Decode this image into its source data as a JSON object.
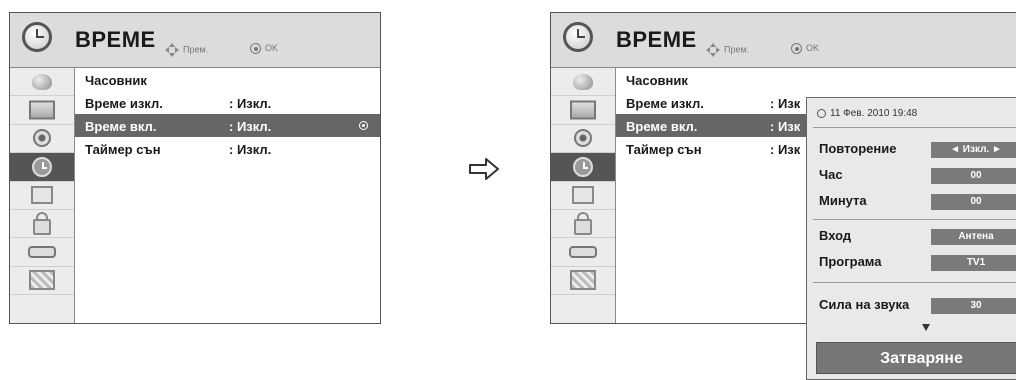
{
  "left_panel": {
    "title": "ВРЕМЕ",
    "hint_move": "Прем.",
    "hint_ok": "OK",
    "sidebar_icons": [
      "satellite-dish-icon",
      "tv-screen-icon",
      "speaker-icon",
      "clock-icon",
      "options-icon",
      "lock-icon",
      "input-plug-icon",
      "media-icon"
    ],
    "active_icon_index": 3,
    "menu": [
      {
        "label": "Часовник",
        "value": ""
      },
      {
        "label": "Време изкл.",
        "value": ": Изкл."
      },
      {
        "label": "Време вкл.",
        "value": ": Изкл.",
        "selected": true
      },
      {
        "label": "Таймер сън",
        "value": ": Изкл."
      }
    ]
  },
  "right_panel": {
    "title": "ВРЕМЕ",
    "hint_move": "Прем.",
    "hint_ok": "OK",
    "menu": [
      {
        "label": "Часовник",
        "value": ""
      },
      {
        "label": "Време изкл.",
        "value": ": Изк"
      },
      {
        "label": "Време вкл.",
        "value": ": Изк",
        "selected": true
      },
      {
        "label": "Таймер сън",
        "value": ": Изк"
      }
    ]
  },
  "popup": {
    "datetime": "11 Фев. 2010 19:48",
    "rows": [
      {
        "label": "Повторение",
        "value": "◄ Изкл. ►"
      },
      {
        "label": "Час",
        "value": "00"
      },
      {
        "label": "Минута",
        "value": "00"
      },
      {
        "label": "Вход",
        "value": "Антена"
      },
      {
        "label": "Програма",
        "value": "TV1"
      },
      {
        "label": "Сила на звука",
        "value": "30"
      }
    ],
    "close_label": "Затваряне"
  },
  "colors": {
    "selected_row": "#666666",
    "header": "#dcdcdc",
    "value_box": "#7a7a7a"
  }
}
